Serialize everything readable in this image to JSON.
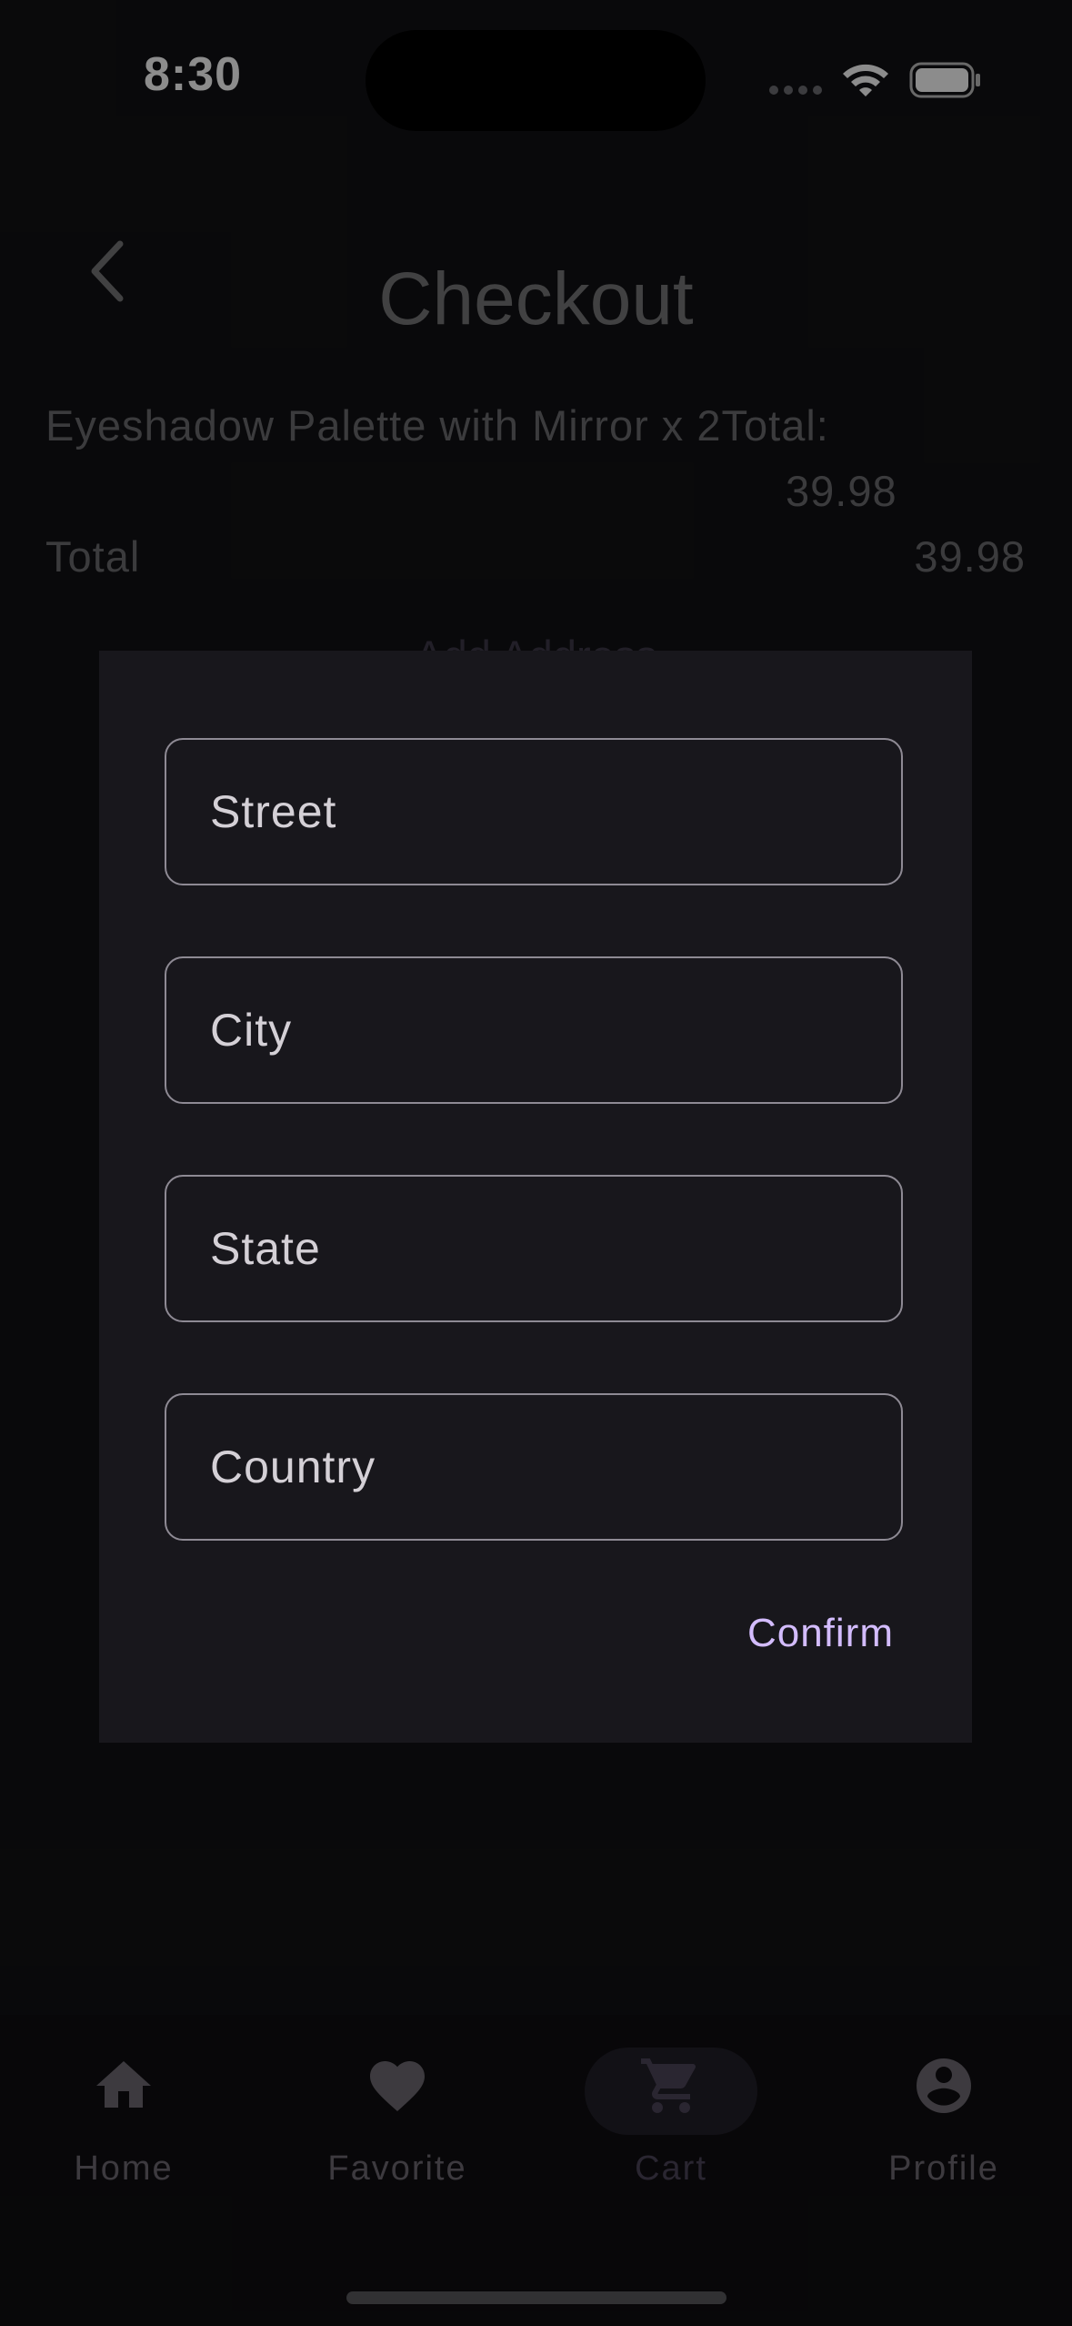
{
  "status_bar": {
    "time": "8:30"
  },
  "header": {
    "title": "Checkout"
  },
  "order": {
    "line": "Eyeshadow Palette with Mirror x 2Total:",
    "line_price": "39.98",
    "total_label": "Total",
    "total_value": "39.98",
    "add_address": "Add Address"
  },
  "dialog": {
    "fields": [
      {
        "placeholder": "Street"
      },
      {
        "placeholder": "City"
      },
      {
        "placeholder": "State"
      },
      {
        "placeholder": "Country"
      }
    ],
    "confirm_label": "Confirm",
    "accent_color": "#d3bcfd"
  },
  "bottom_nav": {
    "items": [
      {
        "label": "Home",
        "icon": "home-icon"
      },
      {
        "label": "Favorite",
        "icon": "heart-icon"
      },
      {
        "label": "Cart",
        "icon": "cart-icon",
        "selected": true
      },
      {
        "label": "Profile",
        "icon": "account-circle-icon"
      }
    ]
  }
}
